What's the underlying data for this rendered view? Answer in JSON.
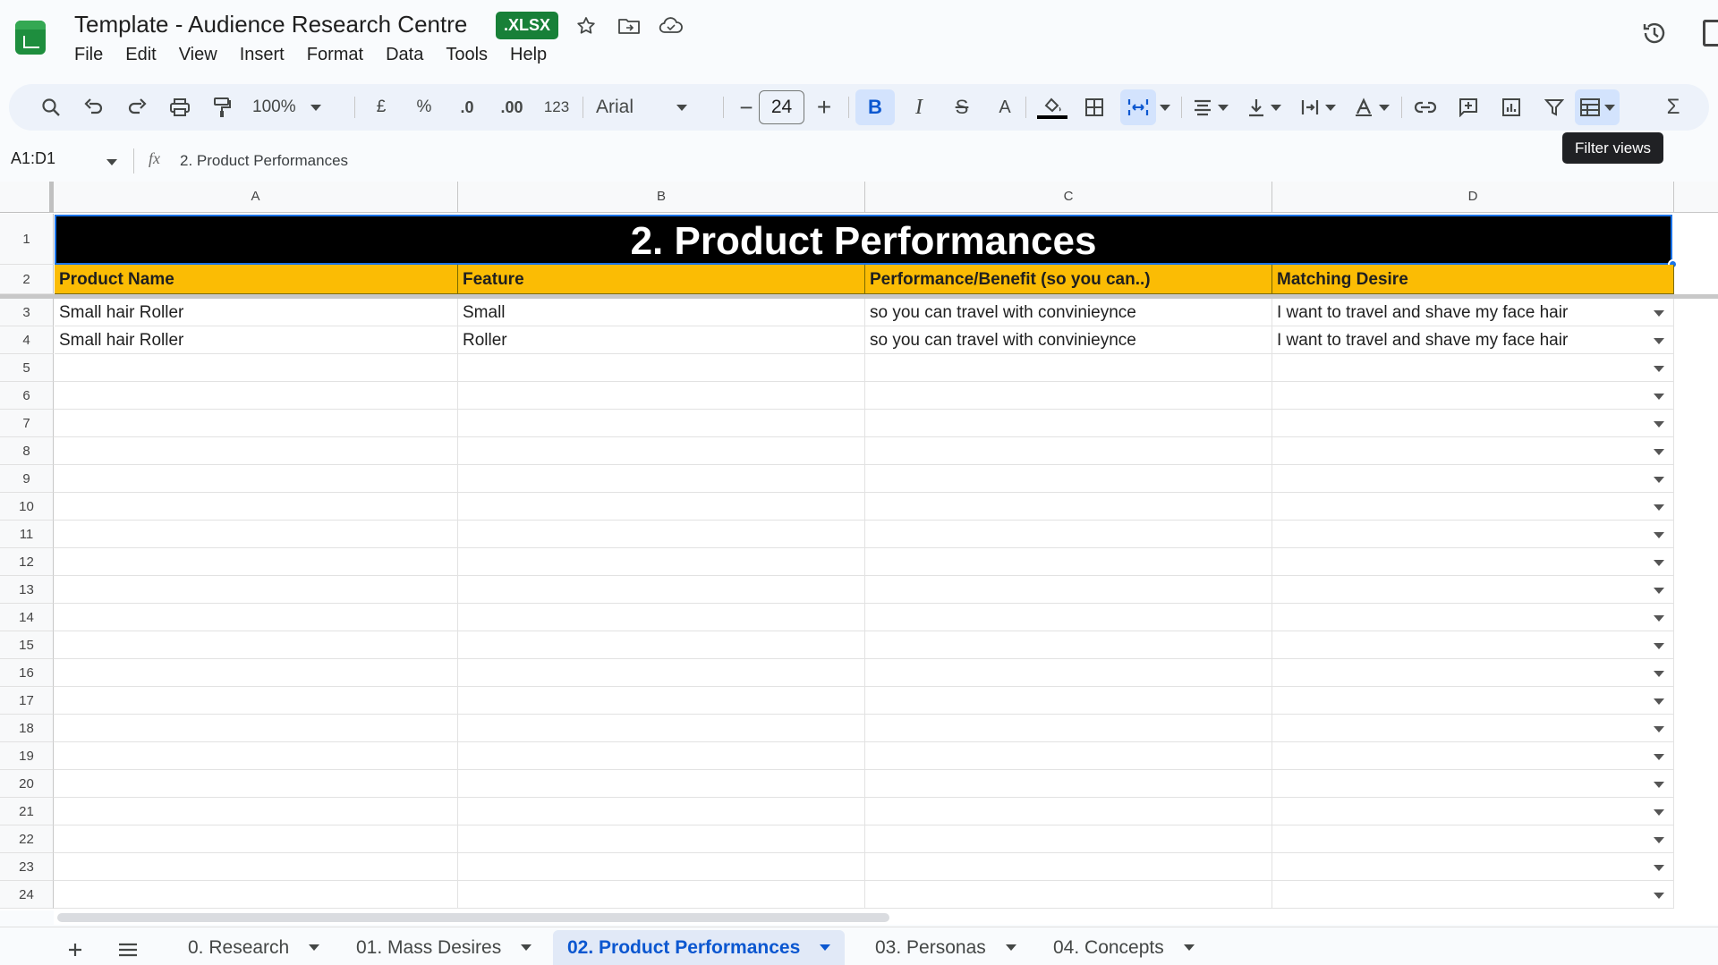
{
  "window": {
    "doc_title": "Template - Audience Research Centre",
    "file_badge": ".XLSX",
    "menu": [
      "File",
      "Edit",
      "View",
      "Insert",
      "Format",
      "Data",
      "Tools",
      "Help"
    ]
  },
  "toolbar": {
    "zoom": "100%",
    "currency": "£",
    "percent": "%",
    "decrease_decimal": ".0",
    "increase_decimal": ".00",
    "number_format": "123",
    "font": "Arial",
    "font_size": "24",
    "tooltip": "Filter views"
  },
  "formula_bar": {
    "range": "A1:D1",
    "fx": "fx",
    "content": "2. Product Performances"
  },
  "sheet": {
    "columns": [
      "A",
      "B",
      "C",
      "D"
    ],
    "row_numbers": [
      "1",
      "2",
      "3",
      "4",
      "5",
      "6",
      "7",
      "8",
      "9",
      "10",
      "11",
      "12",
      "13",
      "14",
      "15",
      "16",
      "17",
      "18",
      "19",
      "20",
      "21",
      "22",
      "23",
      "24"
    ],
    "title": "2. Product Performances",
    "headers": [
      "Product Name",
      "Feature",
      "Performance/Benefit (so you can..)",
      "Matching Desire"
    ],
    "rows": [
      [
        "Small hair Roller",
        "Small",
        "so you can travel with convinieynce",
        "I want to travel and shave my face hair"
      ],
      [
        "Small hair Roller",
        "Roller",
        "so you can travel with convinieynce",
        "I want to travel and shave my face hair"
      ]
    ]
  },
  "tabs": [
    {
      "label": "0. Research",
      "active": false
    },
    {
      "label": "01. Mass Desires",
      "active": false
    },
    {
      "label": "02. Product Performances",
      "active": true
    },
    {
      "label": "03. Personas",
      "active": false
    },
    {
      "label": "04. Concepts",
      "active": false
    }
  ],
  "colors": {
    "title_bg": "#000000",
    "header_bg": "#fbbc04",
    "badge_bg": "#188038",
    "active_tab": "#0b57d0",
    "selection": "#1a73e8"
  }
}
